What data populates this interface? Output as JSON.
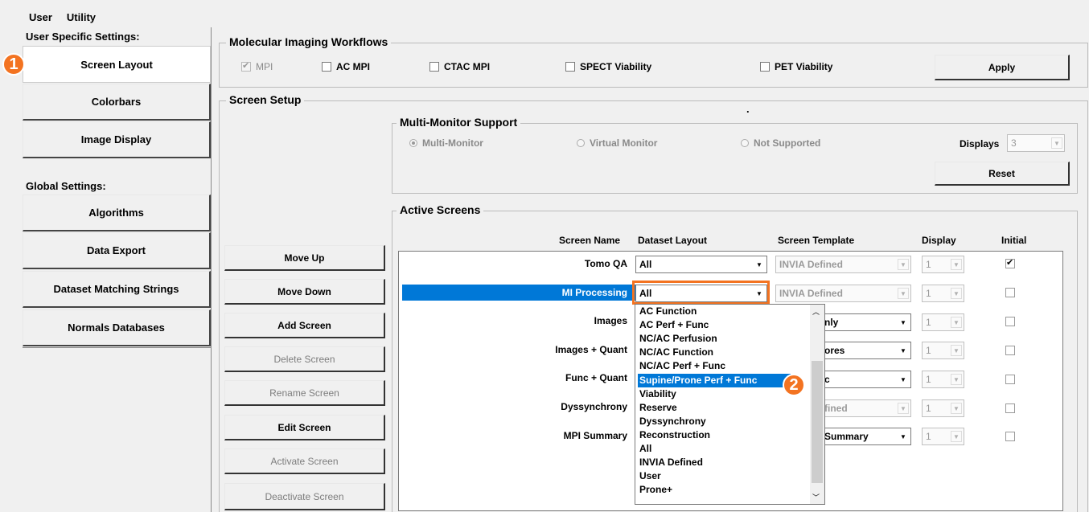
{
  "menubar": [
    "User",
    "Utility"
  ],
  "left_panel": {
    "user_specific_label": "User Specific Settings:",
    "user_buttons": [
      "Screen Layout",
      "Colorbars",
      "Image Display"
    ],
    "global_label": "Global Settings:",
    "global_buttons": [
      "Algorithms",
      "Data Export",
      "Dataset Matching Strings",
      "Normals Databases"
    ]
  },
  "workflows": {
    "title": "Molecular Imaging Workflows",
    "options": [
      {
        "label": "MPI",
        "checked": true,
        "disabled": true
      },
      {
        "label": "AC MPI",
        "checked": false
      },
      {
        "label": "CTAC MPI",
        "checked": false
      },
      {
        "label": "SPECT Viability",
        "checked": false
      },
      {
        "label": "PET Viability",
        "checked": false
      }
    ],
    "apply_label": "Apply"
  },
  "screen_setup": {
    "title": "Screen Setup",
    "dot": "."
  },
  "multi_monitor": {
    "title": "Multi-Monitor Support",
    "options": [
      "Multi-Monitor",
      "Virtual Monitor",
      "Not Supported"
    ],
    "selected": "Multi-Monitor",
    "displays_label": "Displays",
    "displays_value": "3",
    "reset_label": "Reset"
  },
  "screen_buttons": [
    {
      "label": "Move Up",
      "enabled": true
    },
    {
      "label": "Move Down",
      "enabled": true
    },
    {
      "label": "Add Screen",
      "enabled": true
    },
    {
      "label": "Delete Screen",
      "enabled": false
    },
    {
      "label": "Rename Screen",
      "enabled": false
    },
    {
      "label": "Edit Screen",
      "enabled": true
    },
    {
      "label": "Activate Screen",
      "enabled": false
    },
    {
      "label": "Deactivate Screen",
      "enabled": false
    }
  ],
  "active_screens": {
    "title": "Active Screens",
    "headers": [
      "Screen Name",
      "Dataset Layout",
      "Screen Template",
      "Display",
      "Initial"
    ],
    "rows": [
      {
        "name": "Tomo QA",
        "layout": "All",
        "template": "INVIA Defined",
        "display": "1",
        "initial": true
      },
      {
        "name": "MI Processing",
        "layout": "All",
        "template": "INVIA Defined",
        "display": "1",
        "initial": false
      },
      {
        "name": "Images",
        "layout": "",
        "template": "nly",
        "display": "1",
        "initial": false
      },
      {
        "name": "Images + Quant",
        "layout": "",
        "template": "ores",
        "display": "1",
        "initial": false
      },
      {
        "name": "Func + Quant",
        "layout": "",
        "template": "c",
        "display": "1",
        "initial": false
      },
      {
        "name": "Dyssynchrony",
        "layout": "",
        "template": "fined",
        "display": "1",
        "initial": false
      },
      {
        "name": "MPI Summary",
        "layout": "",
        "template": "Summary",
        "display": "1",
        "initial": false
      }
    ]
  },
  "dropdown": {
    "items": [
      "AC Function",
      "AC Perf + Func",
      "NC/AC Perfusion",
      "NC/AC Function",
      "NC/AC Perf + Func",
      "Supine/Prone Perf + Func",
      "Viability",
      "Reserve",
      "Dyssynchrony",
      "Reconstruction",
      "All",
      "INVIA Defined",
      "User",
      "Prone+"
    ],
    "selected": "Supine/Prone Perf + Func"
  },
  "callouts": [
    "1",
    "2"
  ],
  "colors": {
    "accent": "#f37321",
    "selection": "#0078d7"
  }
}
